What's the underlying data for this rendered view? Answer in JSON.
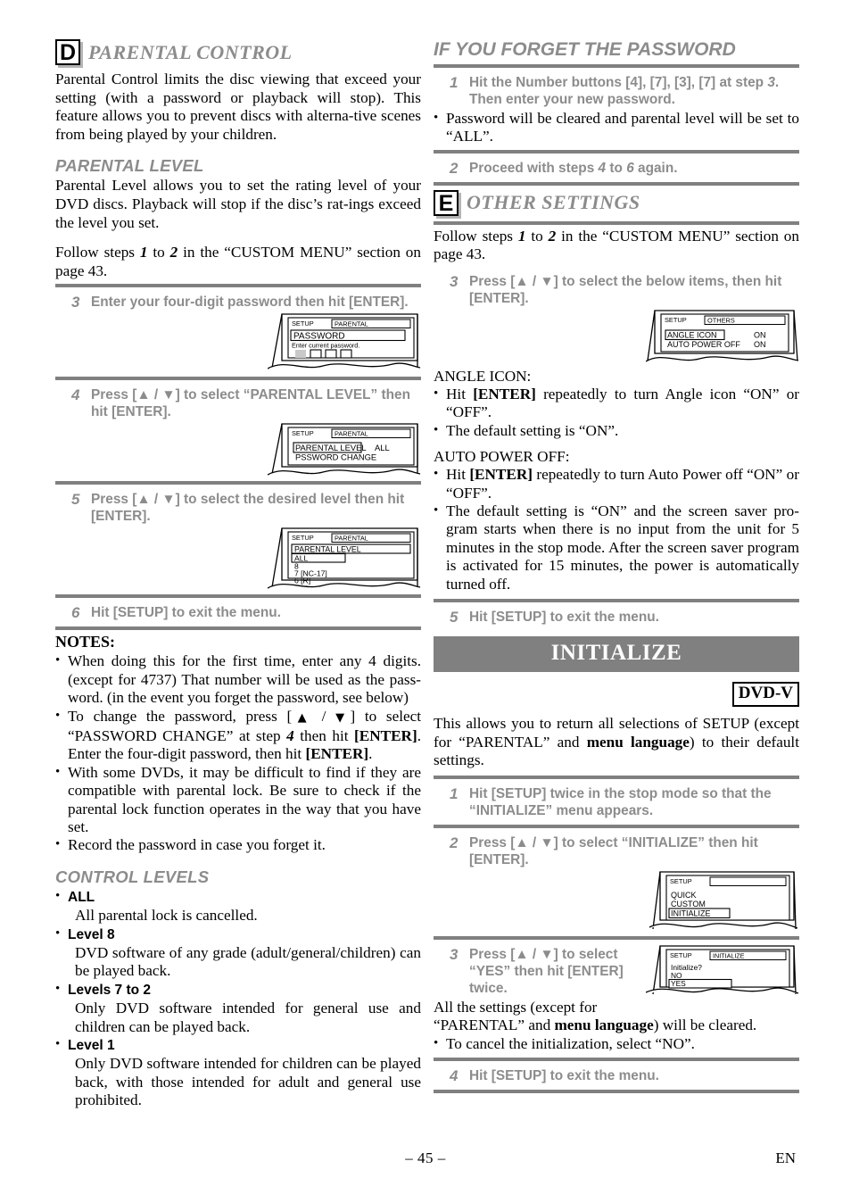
{
  "left": {
    "section_d": {
      "badge": "D",
      "title": "PARENTAL CONTROL",
      "intro": "Parental Control limits the disc viewing that exceed your setting (with a password or playback will stop). This feature allows you to prevent discs with alterna-tive scenes from being played by your children."
    },
    "parental_level": {
      "heading": "PARENTAL LEVEL",
      "intro": "Parental Level allows you to set the rating level of your DVD discs. Playback will stop if the disc’s rat-ings exceed the level you set.",
      "follow": "Follow steps 1 to 2 in the “CUSTOM MENU” sec-tion on page 43.",
      "follow_pre": "Follow steps ",
      "follow_n1": "1",
      "follow_mid": " to ",
      "follow_n2": "2",
      "follow_post": " in the “CUSTOM MENU” section on page 43."
    },
    "steps": [
      {
        "num": "3",
        "text": "Enter your four-digit password then hit [ENTER]."
      },
      {
        "num": "4",
        "text": "Press [▲ / ▼] to select “PARENTAL LEVEL” then hit [ENTER]."
      },
      {
        "num": "5",
        "text": "Press [▲ / ▼] to select the desired level then hit [ENTER]."
      },
      {
        "num": "6",
        "text": "Hit [SETUP] to exit the menu."
      }
    ],
    "screens": {
      "password": {
        "label_setup": "SETUP",
        "label_tab": "PARENTAL",
        "title": "PASSWORD",
        "prompt": "Enter current password.",
        "boxes": 4
      },
      "parental_menu": {
        "label_setup": "SETUP",
        "label_tab": "PARENTAL",
        "row1": "PARENTAL LEVEL",
        "row1_value": "ALL",
        "row2": "PSSWORD CHANGE"
      },
      "level_list": {
        "label_setup": "SETUP",
        "label_tab": "PARENTAL",
        "title": "PARENTAL LEVEL",
        "items": [
          "ALL",
          "8",
          "7 [NC-17]",
          "6 [R]"
        ]
      }
    },
    "notes": {
      "title": "NOTES:",
      "items": [
        "When doing this for the first time, enter any 4 digits. (except for 4737) That number will be used as the pass-word. (in the event you forget the password, see below)",
        "To change the password, press [▲ / ▼] to select “PASSWORD CHANGE” at step 4 then hit [ENTER]. Enter the four-digit password, then hit [ENTER].",
        "With some DVDs, it may be difficult to find if they are compatible with parental lock. Be sure to check if the parental lock function operates in the way that you have set.",
        "Record the password in case you forget it."
      ]
    },
    "control_levels": {
      "heading": "CONTROL LEVELS",
      "items": [
        {
          "name": "ALL",
          "desc": "All parental lock is cancelled."
        },
        {
          "name": "Level 8",
          "desc": "DVD software of any grade (adult/general/children) can be played back."
        },
        {
          "name": "Levels 7 to 2",
          "desc": "Only DVD software intended for general use and children can be played back."
        },
        {
          "name": "Level 1",
          "desc": "Only DVD software intended for children can be played back, with those intended for adult and general use prohibited."
        }
      ]
    }
  },
  "right": {
    "forget": {
      "heading": "IF YOU FORGET THE PASSWORD",
      "step1_num": "1",
      "step1_text": "Hit the Number buttons [4], [7], [3], [7] at step 3. Then enter your new password.",
      "bullet": "Password will be cleared and parental level will be set to “ALL”.",
      "step2_num": "2",
      "step2_text": "Proceed with steps 4 to 6 again."
    },
    "section_e": {
      "badge": "E",
      "title": "OTHER SETTINGS",
      "follow_pre": "Follow steps ",
      "follow_n1": "1",
      "follow_mid": " to ",
      "follow_n2": "2",
      "follow_post": " in the “CUSTOM MENU” section on page 43.",
      "step3_num": "3",
      "step3_text": "Press [▲ / ▼] to select the below items, then hit [ENTER].",
      "step5_num": "5",
      "step5_text": "Hit [SETUP] to exit the menu."
    },
    "others_screen": {
      "label_setup": "SETUP",
      "label_tab": "OTHERS",
      "row1": "ANGLE ICON",
      "row1_value": "ON",
      "row2": "AUTO POWER OFF",
      "row2_value": "ON"
    },
    "angle_icon": {
      "heading": "ANGLE ICON:",
      "bullets": [
        "Hit [ENTER] repeatedly to turn Angle icon “ON” or “OFF”.",
        "The default setting is “ON”."
      ]
    },
    "auto_power": {
      "heading": "AUTO POWER OFF:",
      "bullets": [
        "Hit [ENTER] repeatedly to turn Auto Power off “ON” or “OFF”.",
        "The default setting is “ON” and the screen saver pro-gram starts when there is no input from the unit for 5 minutes in the stop mode. After the screen saver program is activated for 15 minutes, the power is automatically turned off."
      ]
    },
    "initialize": {
      "banner": "INITIALIZE",
      "disc_badge": "DVD-V",
      "intro_a": "This allows you to return all selections of SETUP (except for “PARENTAL” and ",
      "intro_bold": "menu language",
      "intro_b": ") to their default settings.",
      "steps": [
        {
          "num": "1",
          "text": "Hit [SETUP] twice in the stop mode so that the “INITIALIZE” menu appears."
        },
        {
          "num": "2",
          "text": "Press [▲ / ▼] to select “INITIALIZE” then hit [ENTER]."
        },
        {
          "num": "3",
          "text": "Press [▲ / ▼] to select “YES” then hit [ENTER] twice."
        },
        {
          "num": "4",
          "text": "Hit [SETUP] to exit the menu."
        }
      ],
      "after3_a": "All the settings (except for “PARENTAL” and ",
      "after3_bold": "menu language",
      "after3_b": ") will be cleared.",
      "after3_bullet": "To cancel the initialization, select “NO”.",
      "setup_screen": {
        "label_setup": "SETUP",
        "label_tab": "",
        "items": [
          "QUICK",
          "CUSTOM",
          "INITIALIZE"
        ],
        "selected": "INITIALIZE"
      },
      "confirm_screen": {
        "label_setup": "SETUP",
        "label_tab": "INITIALIZE",
        "question": "Initialize?",
        "option_no": "NO",
        "option_yes": "YES"
      }
    }
  },
  "footer": {
    "page_number": "– 45 –",
    "region": "EN"
  },
  "colors": {
    "gray_rule": "#808080",
    "gray_text": "#8c8c8c",
    "banner_bg": "#808080",
    "banner_text": "#ffffff",
    "black": "#000000"
  }
}
